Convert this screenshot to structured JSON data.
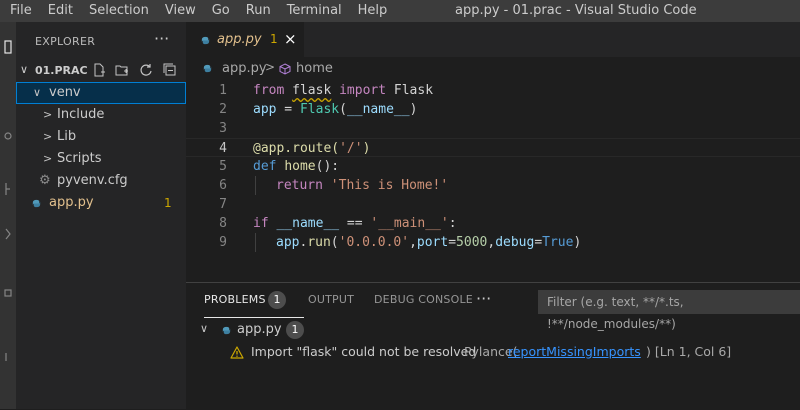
{
  "titlebar": {
    "menu": [
      "File",
      "Edit",
      "Selection",
      "View",
      "Go",
      "Run",
      "Terminal",
      "Help"
    ],
    "title": "app.py - 01.prac - Visual Studio Code"
  },
  "explorer": {
    "title": "EXPLORER",
    "more": "···",
    "folder": "01.PRAC",
    "tree": [
      {
        "label": "venv",
        "chevron": "∨",
        "selected": true
      },
      {
        "label": "Include",
        "chevron": ">"
      },
      {
        "label": "Lib",
        "chevron": ">"
      },
      {
        "label": "Scripts",
        "chevron": ">"
      },
      {
        "label": "pyvenv.cfg",
        "icon": "gear-icon"
      },
      {
        "label": "app.py",
        "icon": "python-icon",
        "badge": "1"
      }
    ]
  },
  "editor": {
    "tab": {
      "label": "app.py",
      "badge": "1",
      "close": "×"
    },
    "breadcrumb": {
      "file": "app.py",
      "separator": ">",
      "symbol": "home"
    },
    "line_numbers": [
      "1",
      "2",
      "3",
      "4",
      "5",
      "6",
      "7",
      "8",
      "9"
    ],
    "current_line": "4",
    "code": {
      "l1": {
        "from": "from",
        "module": "flask",
        "import": "import",
        "name": "Flask"
      },
      "l2": {
        "var": "app",
        "eq": " = ",
        "cls": "Flask",
        "open": "(",
        "arg": "__name__",
        "close": ")"
      },
      "l4": {
        "deco": "@app.route(",
        "str": "'/'",
        "close": ")"
      },
      "l5": {
        "def": "def",
        "fn": "home",
        "rest": "():"
      },
      "l6": {
        "ret": "return",
        "str": "'This is Home!'"
      },
      "l8": {
        "if": "if",
        "var": "__name__",
        "op": " == ",
        "str": "'__main__'",
        "colon": ":"
      },
      "l9": {
        "obj": "app",
        "dot": ".",
        "fn": "run",
        "open": "(",
        "host": "'0.0.0.0'",
        "c1": ",",
        "k1": "port",
        "eq1": "=",
        "port": "5000",
        "c2": ",",
        "k2": "debug",
        "eq2": "=",
        "debug": "True",
        "close": ")"
      }
    }
  },
  "panel": {
    "tabs": {
      "problems": "PROBLEMS",
      "problems_count": "1",
      "output": "OUTPUT",
      "debug": "DEBUG CONSOLE"
    },
    "more": "···",
    "filter_placeholder": "Filter (e.g. text, **/*.ts, !**/node_modules/**)",
    "problem_file": {
      "name": "app.py",
      "count": "1",
      "chevron": "∨"
    },
    "problem": {
      "message": "Import \"flask\" could not be resolved",
      "source": "Pylance",
      "open_paren": "(",
      "code": "reportMissingImports",
      "close_paren": ")",
      "location": "[Ln 1, Col 6]"
    }
  },
  "colors": {
    "accent": "#007fd4",
    "warning": "#cca700",
    "link": "#3794ff"
  }
}
